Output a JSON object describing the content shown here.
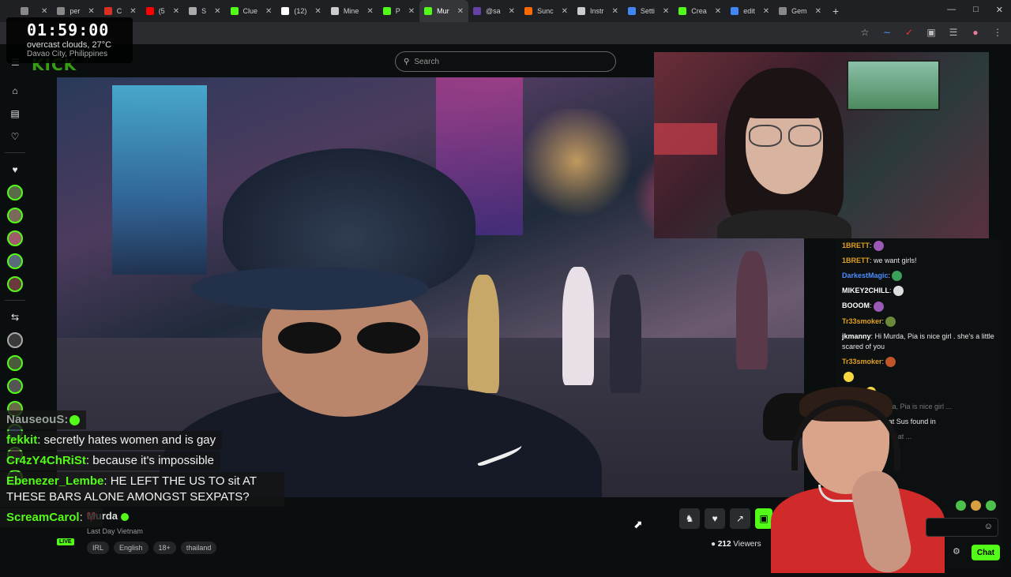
{
  "browser": {
    "tabs": [
      {
        "label": "",
        "color": "#888888"
      },
      {
        "label": "per",
        "color": "#888888"
      },
      {
        "label": "C",
        "color": "#d93025"
      },
      {
        "label": "(5",
        "color": "#ff0000"
      },
      {
        "label": "S",
        "color": "#aaaaaa"
      },
      {
        "label": "Clue",
        "color": "#53fc18"
      },
      {
        "label": "(12)",
        "color": "#ffffff"
      },
      {
        "label": "Mine",
        "color": "#cccccc"
      },
      {
        "label": "P",
        "color": "#53fc18"
      },
      {
        "label": "Mur",
        "color": "#53fc18",
        "active": true
      },
      {
        "label": "@sa",
        "color": "#6441a5"
      },
      {
        "label": "Sunc",
        "color": "#ff6a00"
      },
      {
        "label": "Instr",
        "color": "#cccccc"
      },
      {
        "label": "Setti",
        "color": "#4285f4"
      },
      {
        "label": "Crea",
        "color": "#53fc18"
      },
      {
        "label": "edit",
        "color": "#4285f4"
      },
      {
        "label": "Gem",
        "color": "#888888"
      }
    ]
  },
  "clock": {
    "time": "01:59:00",
    "weather": "overcast clouds, 27°C",
    "location": "Davao City, Philippines"
  },
  "kick": {
    "logo": "KICK",
    "search_placeholder": "Search"
  },
  "overlay_chat": [
    {
      "user": "NauseouS:",
      "message": "",
      "color": "#9aa39a",
      "emote": true
    },
    {
      "user": "fekkit",
      "message": ": secretly hates women and is gay",
      "color": "#53fc18"
    },
    {
      "user": "Cr4zY4ChRiSt",
      "message": ": because it's impossible",
      "color": "#53fc18"
    },
    {
      "user": "Ebenezer_Lembe",
      "message": ": HE LEFT THE US TO sit AT THESE BARS ALONE AMONGST SEXPATS?",
      "color": "#53fc18"
    },
    {
      "user": "ScreamCarol",
      "message": ": ",
      "color": "#53fc18",
      "heart": true
    }
  ],
  "stream": {
    "streamer": "Murda",
    "title": "Last Day Vietnam",
    "live_badge": "LIVE",
    "tags": [
      "IRL",
      "English",
      "18+",
      "thailand"
    ],
    "viewers_count": "212",
    "viewers_label": "Viewers"
  },
  "chat": {
    "messages": [
      {
        "user": "1BRETT",
        "text": ":",
        "color": "#e0a020",
        "emote": "#9b59b6"
      },
      {
        "user": "1BRETT",
        "text": ": we want girls!",
        "color": "#e0a020"
      },
      {
        "user": "DarkestMagic",
        "text": ":",
        "color": "#4c8dff",
        "emote": "#3aa05a"
      },
      {
        "user": "MIKEY2CHILL",
        "text": ":",
        "color": "#ffffff",
        "emote": "#dddddd"
      },
      {
        "user": "BOOOM",
        "text": ":",
        "color": "#ffffff",
        "emote": "#9b59b6"
      },
      {
        "user": "Tr33smoker",
        "text": ":",
        "color": "#e0a020",
        "emote": "#6a8a3a"
      },
      {
        "user": "jkmanny",
        "text": ": Hi Murda, Pia is nice girl . she's a little scared of you",
        "color": "#ffffff"
      },
      {
        "user": "Tr33smoker",
        "text": ":",
        "color": "#e0a020",
        "emote": "#c0552a"
      },
      {
        "user": "",
        "text": "",
        "color": "#e0a020",
        "emote": "#f5d742"
      },
      {
        "user": "",
        "text": "CHILL:",
        "color": "#ffffff",
        "emote": "#f5d742"
      },
      {
        "user": "",
        "text": "manny: Hi Murda, Pia is nice girl ...",
        "color": "#777777",
        "faded": true
      },
      {
        "user": "",
        "text": "'t she a ***** that Sus found in",
        "color": "#e6e6e6"
      },
      {
        "user": "",
        "text": "Isn't she a ***** that ...",
        "color": "#777777",
        "faded": true
      }
    ],
    "send_label": "Chat"
  }
}
